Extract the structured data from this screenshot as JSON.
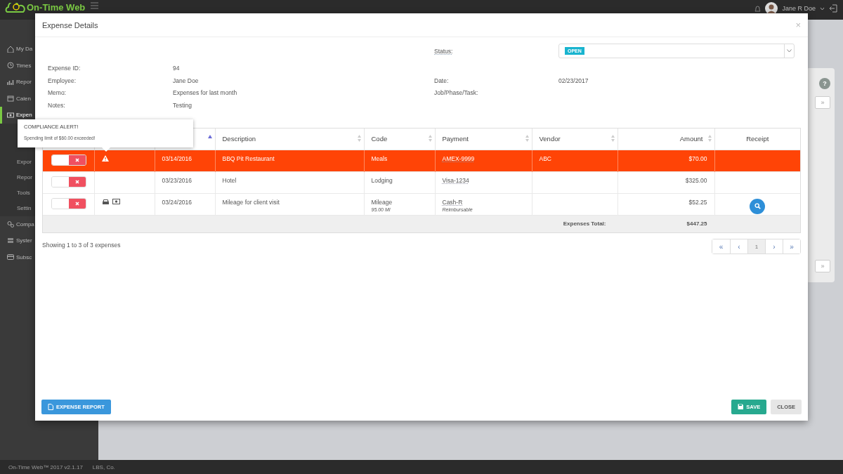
{
  "app": {
    "logo": "On-Time Web",
    "user": "Jane R Doe"
  },
  "sidebar": {
    "items": [
      {
        "label": "My Da",
        "kind": "home",
        "active": false
      },
      {
        "label": "Times",
        "kind": "clock",
        "active": false
      },
      {
        "label": "Repor",
        "kind": "chart",
        "active": false
      },
      {
        "label": "Calen",
        "kind": "calendar",
        "active": false
      },
      {
        "label": "Expen",
        "kind": "cash",
        "active": true,
        "children": [
          {
            "label": "Expor"
          },
          {
            "label": "Repor"
          },
          {
            "label": "Tools"
          },
          {
            "label": "Settin"
          }
        ]
      },
      {
        "label": "Compa",
        "kind": "gears",
        "active": false
      },
      {
        "label": "Syster",
        "kind": "server",
        "active": false
      },
      {
        "label": "Subsc",
        "kind": "card",
        "active": false
      }
    ]
  },
  "background_panel": {
    "help": "?",
    "buttons": [
      "»",
      "»"
    ]
  },
  "status_bar": {
    "version": "On-Time Web™ 2017 v2.1.17",
    "company": "LBS, Co."
  },
  "modal": {
    "title": "Expense Details",
    "close": "×",
    "status": {
      "label": "Status:",
      "value": "OPEN"
    },
    "details_left": [
      {
        "label": "Expense ID:",
        "value": "94"
      },
      {
        "label": "Employee:",
        "value": "Jane Doe"
      },
      {
        "label": "Memo:",
        "value": "Expenses for last month"
      },
      {
        "label": "Notes:",
        "value": "Testing"
      }
    ],
    "details_right": [
      {
        "label": "Date:",
        "value": "02/23/2017"
      },
      {
        "label": "Job/Phase/Task:"
      }
    ],
    "tooltip": {
      "title": "COMPLIANCE ALERT!",
      "text": "Spending limit of $60.00 exceeded!"
    },
    "table": {
      "columns": [
        {},
        {},
        {
          "sortable": true,
          "sorted": true
        },
        {
          "label": "Description",
          "sortable": true,
          "sorted": false
        },
        {
          "label": "Code",
          "sortable": true,
          "sorted": false
        },
        {
          "label": "Payment",
          "sortable": true,
          "sorted": false
        },
        {
          "label": "Vendor",
          "sortable": true,
          "sorted": false
        },
        {
          "label": "Amount",
          "sortable": true,
          "sorted": false
        },
        {
          "label": "Receipt"
        }
      ],
      "rows": [
        {
          "flagged": true,
          "on": false,
          "icons": [
            {
              "kind": "warning"
            }
          ],
          "date": "03/14/2016",
          "description": "BBQ Pit Restaurant",
          "code": "Meals",
          "payment": "AMEX-9999",
          "vendor": "ABC",
          "amount": "$70.00",
          "receipt": false
        },
        {
          "flagged": false,
          "on": false,
          "icons": [],
          "date": "03/23/2016",
          "description": "Hotel",
          "code": "Lodging",
          "payment": "Visa-1234",
          "amount": "$325.00",
          "receipt": false
        },
        {
          "flagged": false,
          "on": false,
          "icons": [
            {
              "kind": "car"
            },
            {
              "kind": "cash"
            }
          ],
          "date": "03/24/2016",
          "description": "Mileage for client visit",
          "code": "Mileage",
          "code_note": "95.00 MI",
          "payment": "Cash-R",
          "payment_note": "Reimbursable",
          "amount": "$52.25",
          "receipt": true
        }
      ],
      "total_label": "Expenses Total:",
      "total": "$447.25"
    },
    "showing": "Showing 1 to 3 of 3 expenses",
    "pagination": [
      {
        "label": "«",
        "selected": false
      },
      {
        "label": "‹",
        "selected": false
      },
      {
        "label": "1",
        "selected": true
      },
      {
        "label": "›",
        "selected": false
      },
      {
        "label": "»",
        "selected": false
      }
    ],
    "buttons": [
      {
        "label": "EXPENSE REPORT",
        "kind": "report"
      },
      {
        "label": "SAVE",
        "kind": "save"
      },
      {
        "label": "CLOSE",
        "kind": "close"
      }
    ]
  }
}
